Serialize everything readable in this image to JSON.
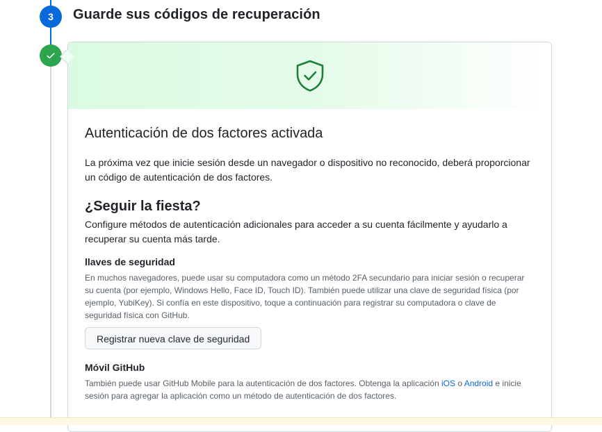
{
  "step": {
    "number": "3",
    "title": "Guarde sus códigos de recuperación"
  },
  "card": {
    "banner_icon": "shield-check-icon",
    "heading": "Autenticación de dos factores activada",
    "intro": "La próxima vez que inicie sesión desde un navegador o dispositivo no reconocido, deberá proporcionar un código de autenticación de dos factores.",
    "continue_heading": "¿Seguir la fiesta?",
    "continue_text": "Configure métodos de autenticación adicionales para acceder a su cuenta fácilmente y ayudarlo a recuperar su cuenta más tarde.",
    "security_keys": {
      "heading": "llaves de seguridad",
      "text": "En muchos navegadores, puede usar su computadora como un método 2FA secundario para iniciar sesión o recuperar su cuenta (por ejemplo, Windows Hello, Face ID, Touch ID). También puede utilizar una clave de seguridad física (por ejemplo, YubiKey). Si confía en este dispositivo, toque a continuación para registrar su computadora o clave de seguridad física con GitHub.",
      "button_label": "Registrar nueva clave de seguridad"
    },
    "mobile": {
      "heading": "Móvil GitHub",
      "text_before": "También puede usar GitHub Mobile para la autenticación de dos factores. Obtenga la aplicación ",
      "ios_link": "iOS",
      "text_or": " o ",
      "android_link": "Android",
      "text_after": " e inicie sesión para agregar la aplicación como un método de autenticación de dos factores."
    }
  },
  "colors": {
    "step_active": "#0969da",
    "step_done": "#2da44e",
    "banner": "#dafbe1",
    "shield": "#1a7f37"
  }
}
